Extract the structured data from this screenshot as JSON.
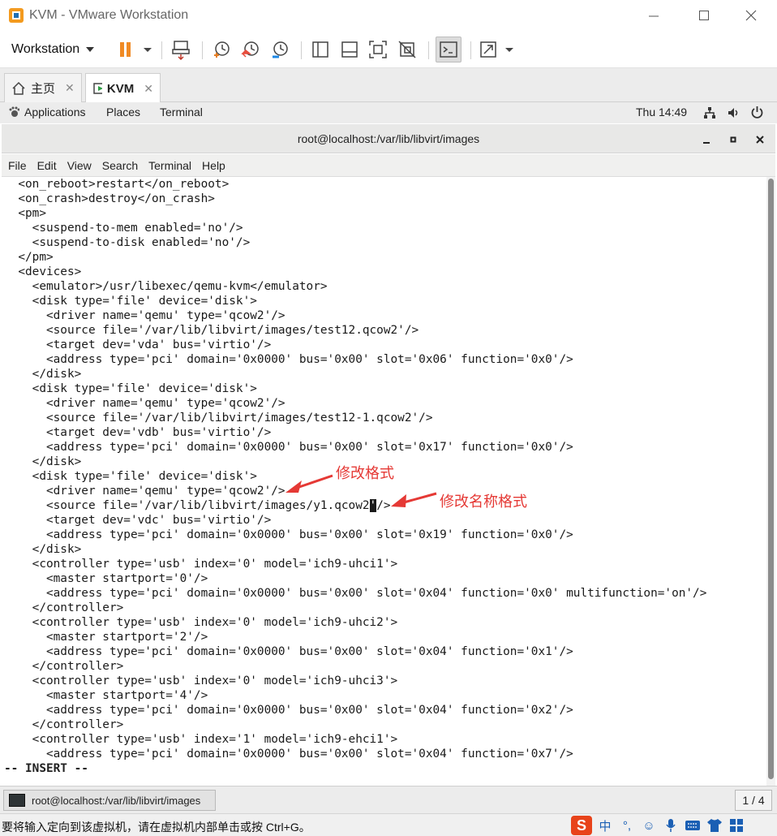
{
  "window": {
    "title": "KVM - VMware Workstation"
  },
  "toolbar": {
    "workstation_menu": "Workstation"
  },
  "tabs": [
    {
      "label": "主页"
    },
    {
      "label": "KVM"
    }
  ],
  "gnome_panel": {
    "applications": "Applications",
    "places": "Places",
    "terminal": "Terminal",
    "clock": "Thu 14:49"
  },
  "terminal": {
    "title": "root@localhost:/var/lib/libvirt/images",
    "menu": [
      "File",
      "Edit",
      "View",
      "Search",
      "Terminal",
      "Help"
    ],
    "lines": [
      "  <on_reboot>restart</on_reboot>",
      "  <on_crash>destroy</on_crash>",
      "  <pm>",
      "    <suspend-to-mem enabled='no'/>",
      "    <suspend-to-disk enabled='no'/>",
      "  </pm>",
      "  <devices>",
      "    <emulator>/usr/libexec/qemu-kvm</emulator>",
      "    <disk type='file' device='disk'>",
      "      <driver name='qemu' type='qcow2'/>",
      "      <source file='/var/lib/libvirt/images/test12.qcow2'/>",
      "      <target dev='vda' bus='virtio'/>",
      "      <address type='pci' domain='0x0000' bus='0x00' slot='0x06' function='0x0'/>",
      "    </disk>",
      "    <disk type='file' device='disk'>",
      "      <driver name='qemu' type='qcow2'/>",
      "      <source file='/var/lib/libvirt/images/test12-1.qcow2'/>",
      "      <target dev='vdb' bus='virtio'/>",
      "      <address type='pci' domain='0x0000' bus='0x00' slot='0x17' function='0x0'/>",
      "    </disk>",
      "    <disk type='file' device='disk'>",
      "      <driver name='qemu' type='qcow2'/>",
      "      <source file='/var/lib/libvirt/images/y1.qcow2'/>",
      "      <target dev='vdc' bus='virtio'/>",
      "      <address type='pci' domain='0x0000' bus='0x00' slot='0x19' function='0x0'/>",
      "    </disk>",
      "    <controller type='usb' index='0' model='ich9-uhci1'>",
      "      <master startport='0'/>",
      "      <address type='pci' domain='0x0000' bus='0x00' slot='0x04' function='0x0' multifunction='on'/>",
      "    </controller>",
      "    <controller type='usb' index='0' model='ich9-uhci2'>",
      "      <master startport='2'/>",
      "      <address type='pci' domain='0x0000' bus='0x00' slot='0x04' function='0x1'/>",
      "    </controller>",
      "    <controller type='usb' index='0' model='ich9-uhci3'>",
      "      <master startport='4'/>",
      "      <address type='pci' domain='0x0000' bus='0x00' slot='0x04' function='0x2'/>",
      "    </controller>",
      "    <controller type='usb' index='1' model='ich9-ehci1'>",
      "      <address type='pci' domain='0x0000' bus='0x00' slot='0x04' function='0x7'/>"
    ],
    "cursor_line": 22,
    "cursor_char": "'",
    "mode_line": "-- INSERT --"
  },
  "annotations": {
    "format_note": "修改格式",
    "name_format_note": "修改名称格式",
    "color": "#e53935"
  },
  "taskbar": {
    "item_label": "root@localhost:/var/lib/libvirt/images",
    "page_count": "1 / 4"
  },
  "statusbar": {
    "hint": "要将输入定向到该虚拟机，请在虚拟机内部单击或按 Ctrl+G。",
    "ime_mode": "中"
  }
}
